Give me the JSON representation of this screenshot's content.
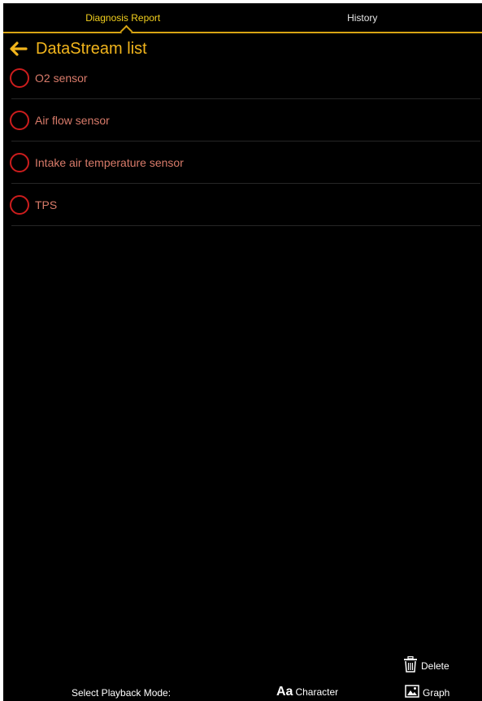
{
  "tabs": [
    {
      "label": "Diagnosis Report",
      "active": true
    },
    {
      "label": "History",
      "active": false
    }
  ],
  "header": {
    "back_icon": "back-arrow-icon",
    "title": "DataStream list"
  },
  "datastream_items": [
    {
      "label": "O2 sensor"
    },
    {
      "label": "Air flow sensor"
    },
    {
      "label": "Intake air temperature sensor"
    },
    {
      "label": "TPS"
    }
  ],
  "footer": {
    "playback_label": "Select Playback Mode:",
    "character_icon": "Aa",
    "character_label": "Character",
    "graph_label": "Graph",
    "delete_label": "Delete"
  },
  "colors": {
    "background": "#000000",
    "accent": "#f2b51c",
    "active_tab": "#f2cf1d",
    "radio_ring": "#cc1d1d",
    "item_text": "#d97b6a"
  }
}
